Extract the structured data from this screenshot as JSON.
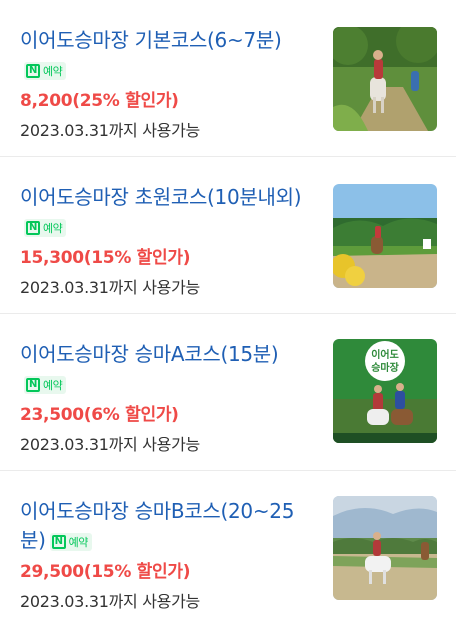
{
  "items": [
    {
      "title": "이어도승마장 기본코스(6~7분)",
      "badge": "예약",
      "price": "8,200(25% 할인가)",
      "date": "2023.03.31까지 사용가능"
    },
    {
      "title": "이어도승마장 초원코스(10분내외)",
      "badge": "예약",
      "price": "15,300(15% 할인가)",
      "date": "2023.03.31까지 사용가능"
    },
    {
      "title": "이어도승마장 승마A코스(15분)",
      "badge": "예약",
      "price": "23,500(6% 할인가)",
      "date": "2023.03.31까지 사용가능",
      "thumb_logo": "이어도 승마장"
    },
    {
      "title": "이어도승마장 승마B코스(20~25분)",
      "badge": "예약",
      "price": "29,500(15% 할인가)",
      "date": "2023.03.31까지 사용가능"
    }
  ],
  "colors": {
    "title": "#1f5fb4",
    "price": "#ef4a47",
    "naver_green": "#03c75a"
  }
}
